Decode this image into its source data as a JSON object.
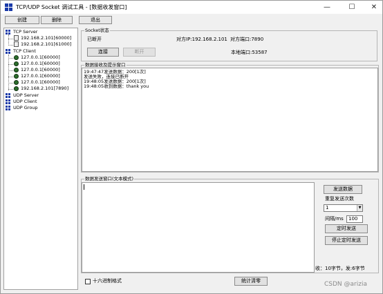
{
  "window": {
    "title": "TCP/UDP Socket 调试工具 - [数据收发窗口]",
    "minimize": "—",
    "maximize": "☐",
    "close": "✕"
  },
  "toolbar": {
    "create": "创建",
    "delete": "删除",
    "exit": "退出"
  },
  "tree": {
    "tcp_server": "TCP Server",
    "tcp_server_items": [
      "192.168.2.101[60000]",
      "192.168.2.101[61000]"
    ],
    "tcp_client": "TCP Client",
    "tcp_client_items": [
      "127.0.0.1[60000]",
      "127.0.0.1[60000]",
      "127.0.0.1[60000]",
      "127.0.0.1[60000]",
      "127.0.0.1[60000]",
      "192.168.2.101[7890]"
    ],
    "udp_server": "UDP Server",
    "udp_client": "UDP Client",
    "udp_group": "UDP Group"
  },
  "socket_status": {
    "group_title": "Socket状态",
    "state": "已断开",
    "remote_ip": "对方IP:192.168.2.101",
    "remote_port": "对方端口:7890",
    "local_port": "本地端口:53587",
    "connect_label": "连接",
    "disconnect_label": "断开"
  },
  "receive": {
    "group_title": "数据接收及提示窗口",
    "lines": [
      "19:47:47发送数据：200[1次]",
      "发送失败，连接已断开",
      "19:48:05发送数据：200[1次]",
      "19:48:05收到数据：thank you"
    ]
  },
  "send": {
    "group_title": "数据发送窗口(文本模式)",
    "send_button": "发送数据",
    "repeat_label": "重复发送次数",
    "repeat_value": "1",
    "interval_label": "间隔/ms",
    "interval_value": "100",
    "timed_send": "定时发送",
    "stop_timed_send": "停止定时发送",
    "stats": "收：10字节，发:6字节"
  },
  "bottom": {
    "hex_label": "十六进制格式",
    "reset_stats": "统计清零"
  },
  "watermark": "CSDN @arizia",
  "colors": {
    "window_bg": "#f0f0f0",
    "net_icon": "#1a3aa8",
    "client_icon": "#2c6e2c"
  }
}
